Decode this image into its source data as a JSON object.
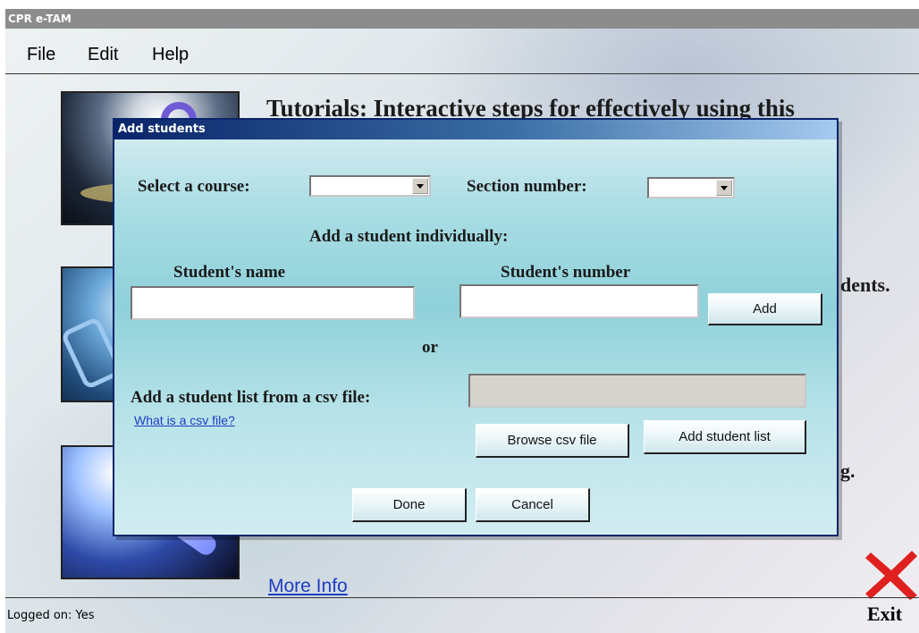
{
  "app": {
    "title": "CPR e-TAM"
  },
  "menu": {
    "file": "File",
    "edit": "Edit",
    "help": "Help"
  },
  "background": {
    "tutorials_text": "Tutorials: Interactive steps for effectively using this",
    "fragment_students": "dents.",
    "fragment_g": "g.",
    "more_info": "More Info",
    "exit_label": "Exit",
    "status": "Logged on: Yes"
  },
  "dialog": {
    "title": "Add students",
    "select_course_label": "Select a course:",
    "select_course_value": "",
    "section_label": "Section number:",
    "section_value": "",
    "individual_heading": "Add a student individually:",
    "student_name_label": "Student's name",
    "student_name_value": "",
    "student_number_label": "Student's number",
    "student_number_value": "",
    "add_button": "Add",
    "or_text": "or",
    "csv_label": "Add a student list from a csv file:",
    "csv_value": "",
    "csv_help_link": "What is a csv file?",
    "browse_button": "Browse csv file",
    "add_list_button": "Add student list",
    "done_button": "Done",
    "cancel_button": "Cancel"
  },
  "colors": {
    "dialog_title_bar": "#0a246a",
    "link": "#1f3dc4",
    "exit_x": "#e0201e"
  }
}
